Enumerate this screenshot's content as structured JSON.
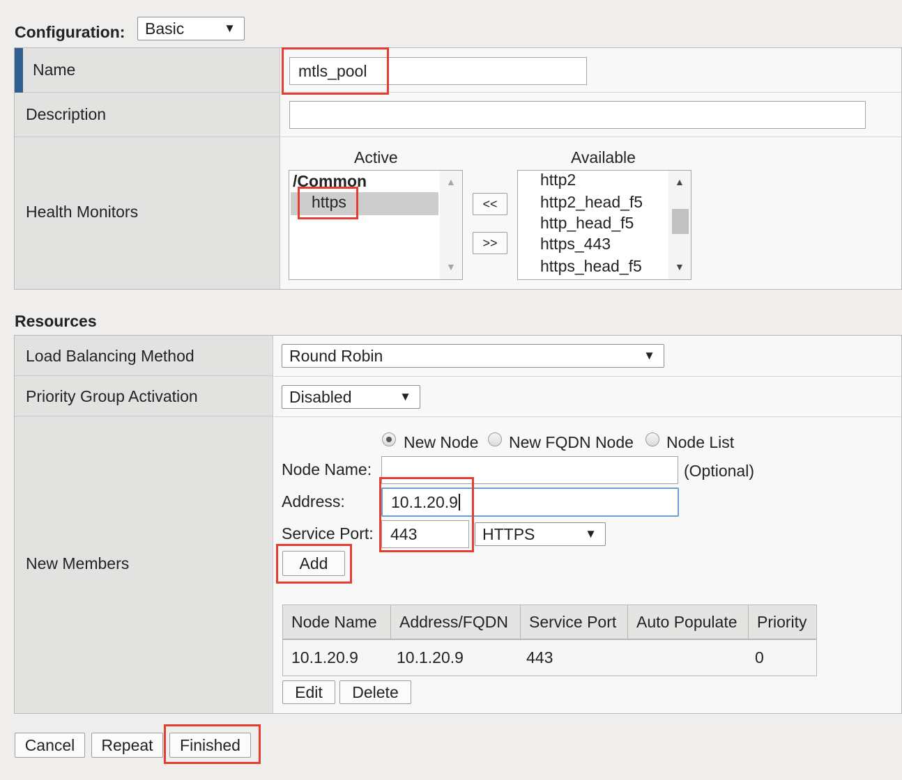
{
  "config": {
    "label": "Configuration:",
    "value": "Basic"
  },
  "general": {
    "name_label": "Name",
    "name_value": "mtls_pool",
    "description_label": "Description",
    "description_value": "",
    "health_label": "Health Monitors",
    "active_header": "Active",
    "available_header": "Available",
    "active_items": [
      "/Common",
      "https"
    ],
    "available_items": [
      "http2",
      "http2_head_f5",
      "http_head_f5",
      "https_443",
      "https_head_f5"
    ],
    "move_left": "<<",
    "move_right": ">>"
  },
  "resources": {
    "title": "Resources",
    "lb_label": "Load Balancing Method",
    "lb_value": "Round Robin",
    "pga_label": "Priority Group Activation",
    "pga_value": "Disabled",
    "members_label": "New Members",
    "radios": [
      {
        "label": "New Node",
        "selected": true
      },
      {
        "label": "New FQDN Node",
        "selected": false
      },
      {
        "label": "Node List",
        "selected": false
      }
    ],
    "node_name_label": "Node Name:",
    "node_name_value": "",
    "optional": "(Optional)",
    "address_label": "Address:",
    "address_value": "10.1.20.9",
    "port_label": "Service Port:",
    "port_value": "443",
    "port_service": "HTTPS",
    "add_button": "Add",
    "table": {
      "columns": [
        "Node Name",
        "Address/FQDN",
        "Service Port",
        "Auto Populate",
        "Priority"
      ],
      "rows": [
        [
          "10.1.20.9",
          "10.1.20.9",
          "443",
          "",
          "0"
        ]
      ]
    },
    "edit_button": "Edit",
    "delete_button": "Delete"
  },
  "actions": {
    "cancel": "Cancel",
    "repeat": "Repeat",
    "finished": "Finished"
  },
  "colors": {
    "highlight_box": "#e53e31",
    "name_accent": "#2e5f8f",
    "focus_border": "#6b9fd6"
  }
}
